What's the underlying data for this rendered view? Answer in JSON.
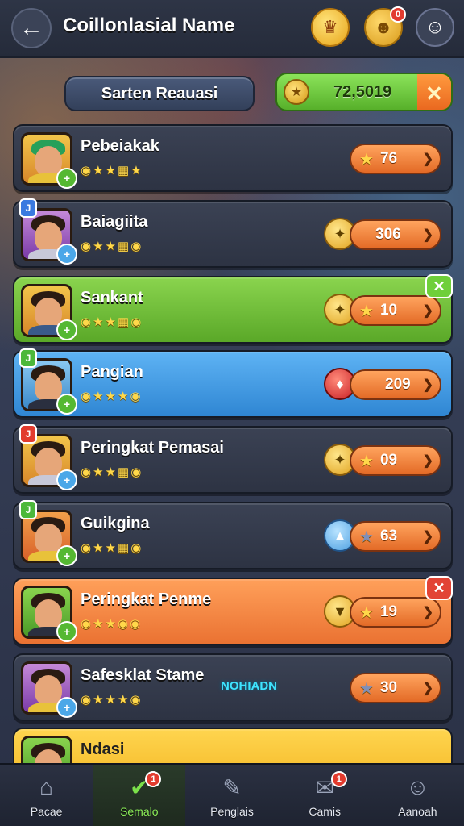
{
  "header": {
    "back_icon": "arrow-left-icon",
    "title": "Coillonlasial Name",
    "trophy_badge": "",
    "pet_badge": "0"
  },
  "subheader": {
    "search_label": "Sarten Reauasi",
    "currency_value": "72,5019"
  },
  "rows": [
    {
      "name": "Pebeiakak",
      "score": "76",
      "style": "dark",
      "corner": ""
    },
    {
      "name": "Baiagiita",
      "score": "306",
      "style": "dark",
      "corner": "J"
    },
    {
      "name": "Sankant",
      "score": "10",
      "style": "green",
      "corner": ""
    },
    {
      "name": "Pangian",
      "score": "209",
      "style": "blue",
      "corner": "J"
    },
    {
      "name": "Peringkat Pemasai",
      "score": "09",
      "style": "dark",
      "corner": "J"
    },
    {
      "name": "Guikgina",
      "score": "63",
      "style": "dark",
      "corner": "J"
    },
    {
      "name": "Peringkat Penme",
      "score": "19",
      "style": "orange",
      "corner": ""
    },
    {
      "name": "Safesklat Stame",
      "score": "30",
      "style": "dark",
      "tag": "NOHIADN",
      "corner": ""
    },
    {
      "name": "Ndasi",
      "score": "",
      "style": "yellow",
      "corner": ""
    }
  ],
  "nav": [
    {
      "label": "Pacae",
      "icon": "home-icon",
      "badge": ""
    },
    {
      "label": "Semalo",
      "icon": "check-icon",
      "badge": "1"
    },
    {
      "label": "Penglais",
      "icon": "edit-icon",
      "badge": ""
    },
    {
      "label": "Camis",
      "icon": "chat-icon",
      "badge": "1"
    },
    {
      "label": "Aanoah",
      "icon": "user-icon",
      "badge": ""
    }
  ],
  "colors": {
    "accent_green": "#5aa828",
    "accent_blue": "#2f86d3",
    "accent_orange": "#ea7232"
  }
}
